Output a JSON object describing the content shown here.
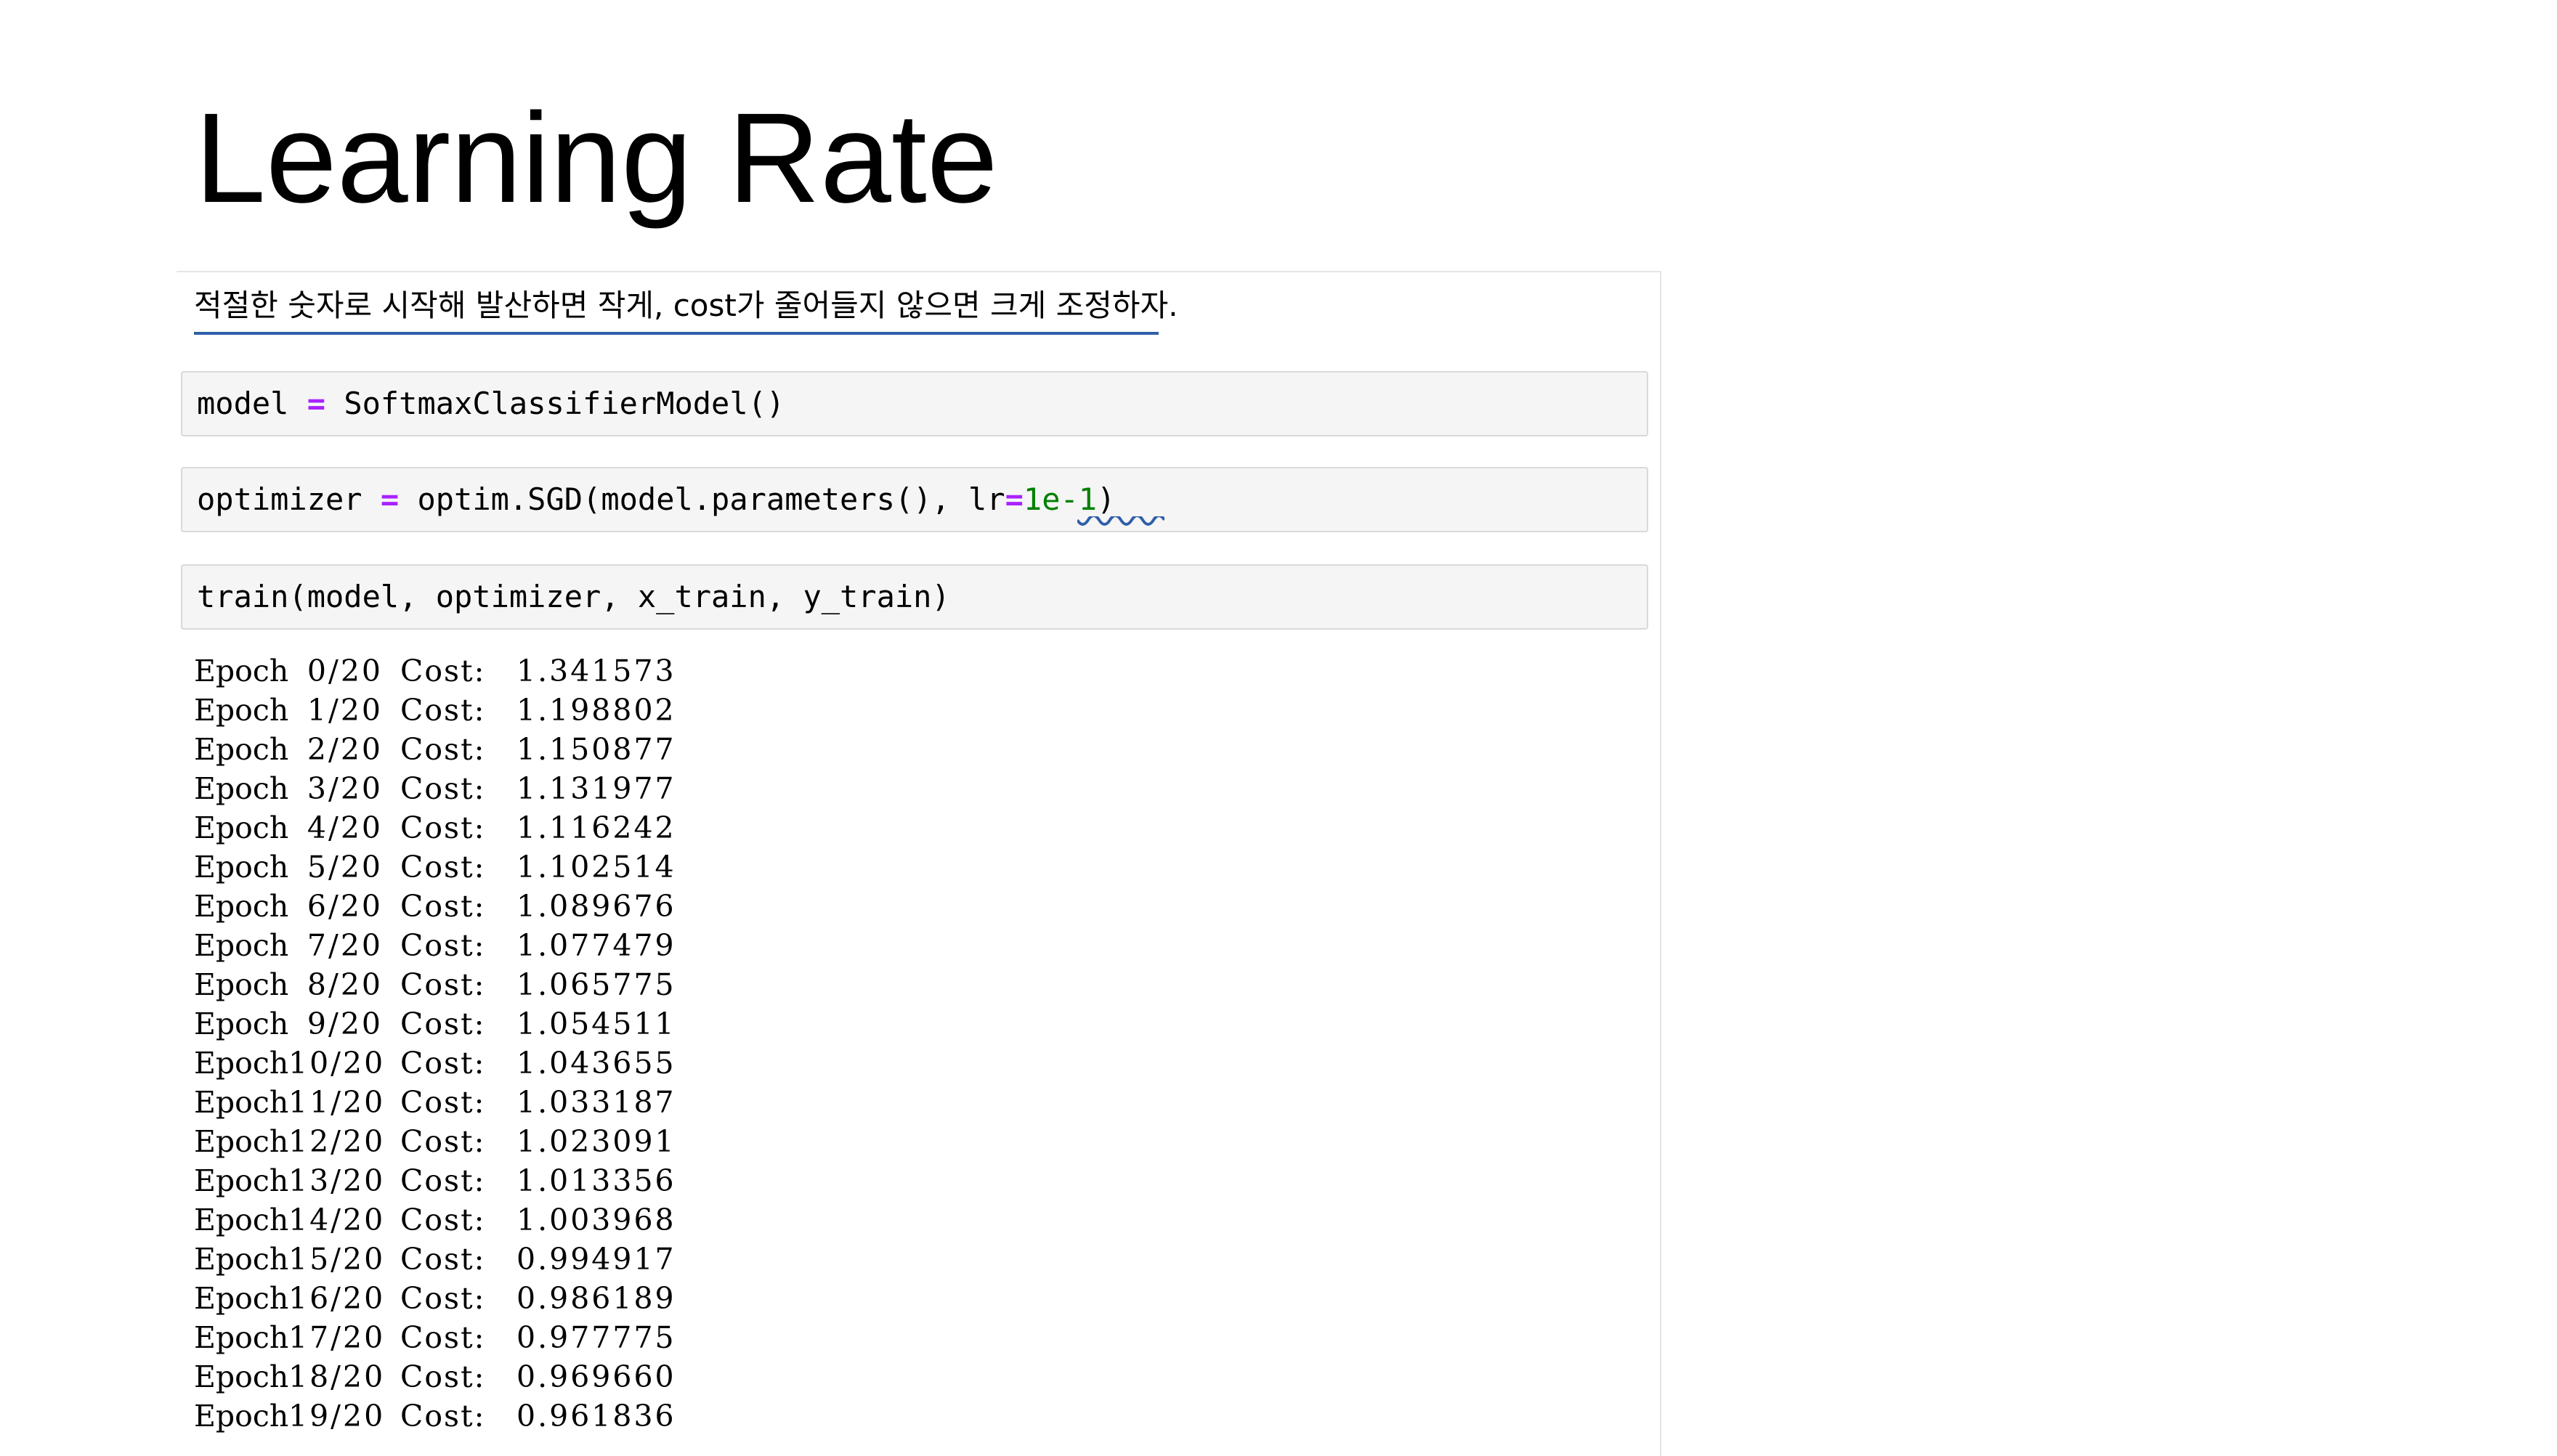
{
  "slide": {
    "title": "Learning Rate"
  },
  "markdown": {
    "text": "적절한 숫자로 시작해 발산하면 작게, cost가 줄어들지 않으면 크게 조정하자."
  },
  "cells": {
    "model": {
      "var": "model",
      "op": "=",
      "rhs": "SoftmaxClassifierModel()"
    },
    "optimizer": {
      "var": "optimizer",
      "op": "=",
      "call": "optim.SGD(model.parameters(), lr",
      "kwop": "=",
      "lr_value": "1e-1",
      "close": ")"
    },
    "train": {
      "code": "train(model, optimizer, x_train, y_train)"
    }
  },
  "output": {
    "rows": [
      {
        "word": "Epoch",
        "epoch": "0/20",
        "label": "Cost:",
        "cost": "1.341573"
      },
      {
        "word": "Epoch",
        "epoch": "1/20",
        "label": "Cost:",
        "cost": "1.198802"
      },
      {
        "word": "Epoch",
        "epoch": "2/20",
        "label": "Cost:",
        "cost": "1.150877"
      },
      {
        "word": "Epoch",
        "epoch": "3/20",
        "label": "Cost:",
        "cost": "1.131977"
      },
      {
        "word": "Epoch",
        "epoch": "4/20",
        "label": "Cost:",
        "cost": "1.116242"
      },
      {
        "word": "Epoch",
        "epoch": "5/20",
        "label": "Cost:",
        "cost": "1.102514"
      },
      {
        "word": "Epoch",
        "epoch": "6/20",
        "label": "Cost:",
        "cost": "1.089676"
      },
      {
        "word": "Epoch",
        "epoch": "7/20",
        "label": "Cost:",
        "cost": "1.077479"
      },
      {
        "word": "Epoch",
        "epoch": "8/20",
        "label": "Cost:",
        "cost": "1.065775"
      },
      {
        "word": "Epoch",
        "epoch": "9/20",
        "label": "Cost:",
        "cost": "1.054511"
      },
      {
        "word": "Epoch",
        "epoch": "10/20",
        "label": "Cost:",
        "cost": "1.043655"
      },
      {
        "word": "Epoch",
        "epoch": "11/20",
        "label": "Cost:",
        "cost": "1.033187"
      },
      {
        "word": "Epoch",
        "epoch": "12/20",
        "label": "Cost:",
        "cost": "1.023091"
      },
      {
        "word": "Epoch",
        "epoch": "13/20",
        "label": "Cost:",
        "cost": "1.013356"
      },
      {
        "word": "Epoch",
        "epoch": "14/20",
        "label": "Cost:",
        "cost": "1.003968"
      },
      {
        "word": "Epoch",
        "epoch": "15/20",
        "label": "Cost:",
        "cost": "0.994917"
      },
      {
        "word": "Epoch",
        "epoch": "16/20",
        "label": "Cost:",
        "cost": "0.986189"
      },
      {
        "word": "Epoch",
        "epoch": "17/20",
        "label": "Cost:",
        "cost": "0.977775"
      },
      {
        "word": "Epoch",
        "epoch": "18/20",
        "label": "Cost:",
        "cost": "0.969660"
      },
      {
        "word": "Epoch",
        "epoch": "19/20",
        "label": "Cost:",
        "cost": "0.961836"
      }
    ]
  },
  "colors": {
    "operator": "#aa22ff",
    "number": "#008000",
    "underline": "#2f5fa8"
  }
}
